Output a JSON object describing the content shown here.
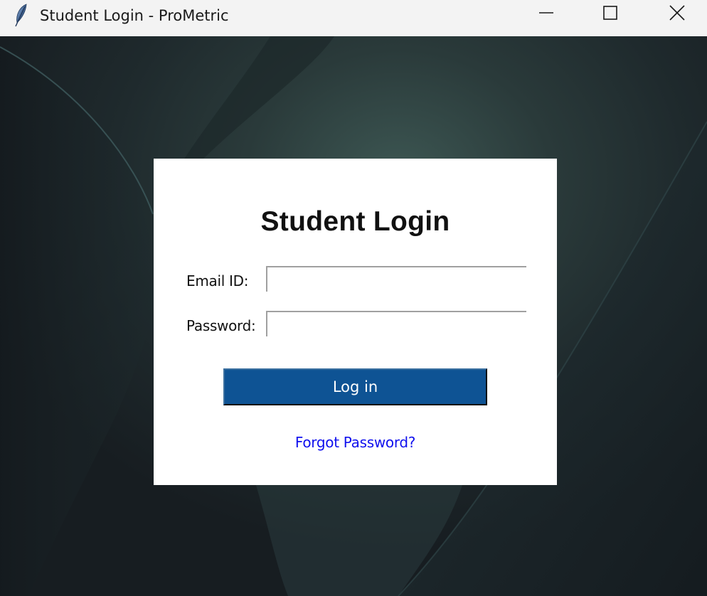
{
  "window": {
    "title": "Student Login - ProMetric",
    "icon": "feather-icon",
    "controls": [
      "minimize-icon",
      "maximize-icon",
      "close-icon"
    ]
  },
  "login": {
    "heading": "Student Login",
    "email_label": "Email ID:",
    "email_value": "",
    "password_label": "Password:",
    "password_value": "",
    "login_button": "Log in",
    "forgot_link": "Forgot Password?"
  },
  "colors": {
    "button_bg": "#0e5394",
    "link": "#1010ee",
    "card_bg": "#ffffff",
    "titlebar_bg": "#f3f3f3"
  }
}
